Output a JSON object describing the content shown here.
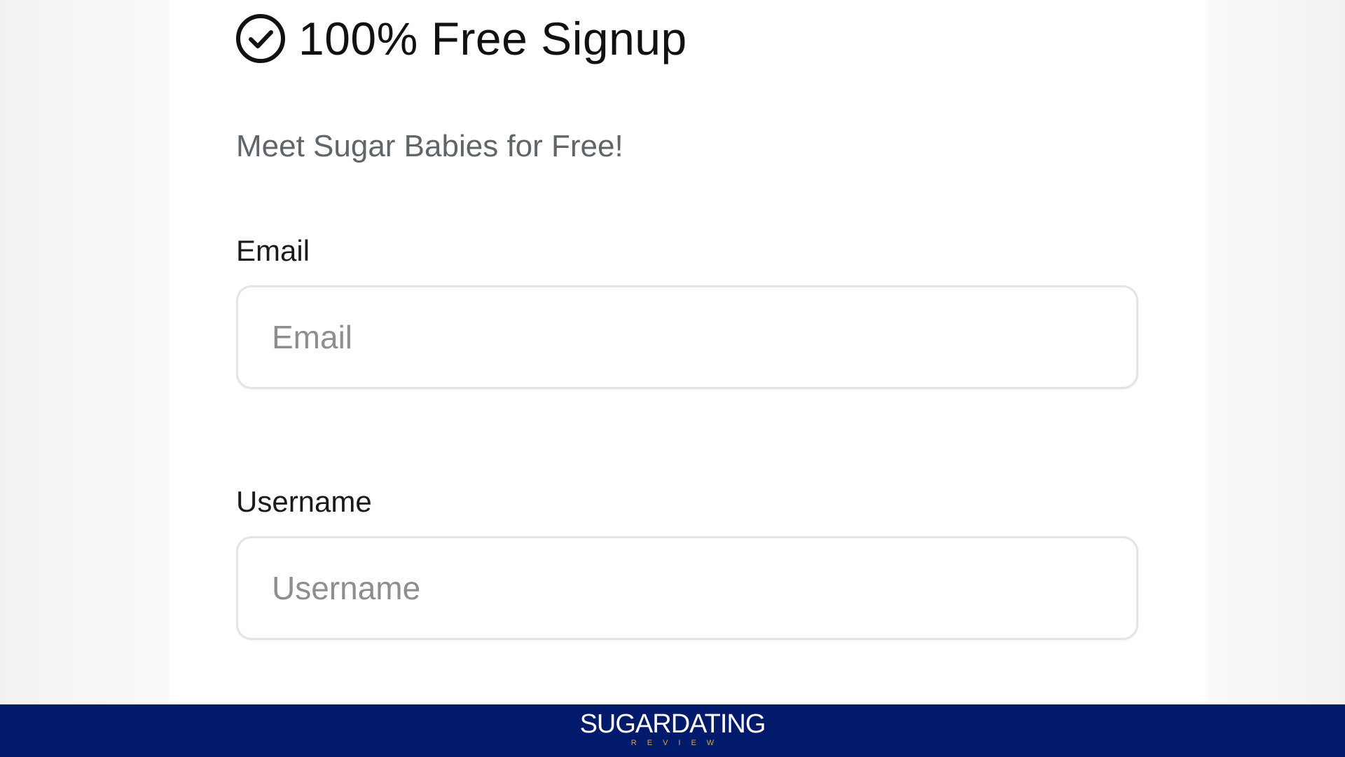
{
  "header": {
    "title": "100% Free Signup",
    "subtitle": "Meet Sugar Babies for Free!"
  },
  "form": {
    "email": {
      "label": "Email",
      "placeholder": "Email",
      "value": ""
    },
    "username": {
      "label": "Username",
      "placeholder": "Username",
      "value": ""
    }
  },
  "footer": {
    "logo_main": "SUGARDATING",
    "logo_sub": "REVIEW"
  },
  "colors": {
    "footer_background": "#021a6b",
    "logo_accent": "#d9a73d"
  },
  "icons": {
    "title_icon": "check-circle-icon"
  }
}
